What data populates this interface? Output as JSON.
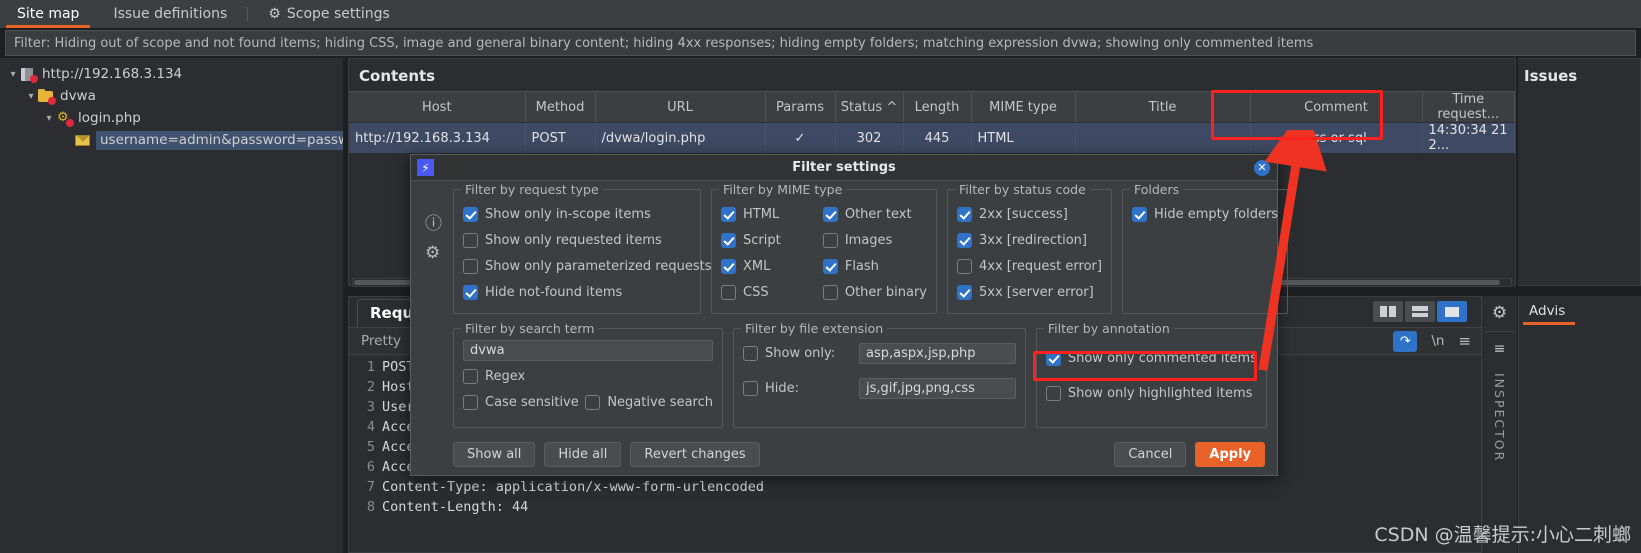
{
  "top_tabs": [
    {
      "label": "Site map",
      "active": true,
      "icon": null
    },
    {
      "label": "Issue definitions",
      "active": false,
      "icon": null
    },
    {
      "label": "Scope settings",
      "active": false,
      "icon": "gear-icon"
    }
  ],
  "filter_bar": {
    "text": "Filter: Hiding out of scope and not found items;  hiding CSS, image and general binary content;  hiding 4xx responses;  hiding empty folders;  matching expression dvwa;  showing only commented items"
  },
  "site_map_tree": [
    {
      "label": "http://192.168.3.134",
      "indent": 0,
      "icon": "host-icon",
      "expanded": true,
      "selected": false
    },
    {
      "label": "dvwa",
      "indent": 1,
      "icon": "folder-icon",
      "expanded": true,
      "selected": false
    },
    {
      "label": "login.php",
      "indent": 2,
      "icon": "php-gear-icon",
      "expanded": true,
      "selected": false
    },
    {
      "label": "username=admin&password=passwo",
      "indent": 3,
      "icon": "request-mail-icon",
      "expanded": false,
      "selected": true
    }
  ],
  "contents": {
    "title": "Contents",
    "columns": [
      "Host",
      "Method",
      "URL",
      "Params",
      "Status ^",
      "Length",
      "MIME type",
      "Title",
      "Comment",
      "Time request..."
    ],
    "rows": [
      {
        "Host": "http://192.168.3.134",
        "Method": "POST",
        "URL": "/dvwa/login.php",
        "Params": "✓",
        "Status": "302",
        "Length": "445",
        "MIME type": "HTML",
        "Title": "",
        "Comment": "xss or sql",
        "Time requested": "14:30:34 21 2..."
      }
    ]
  },
  "issues_panel": {
    "title": "Issues"
  },
  "request_panel": {
    "tab_label": "Reque",
    "pretty_label": "Pretty",
    "view_buttons": [
      {
        "name": "split-view-button",
        "active": false
      },
      {
        "name": "stacked-view-button",
        "active": false
      },
      {
        "name": "single-view-button",
        "active": true
      }
    ],
    "tools": [
      {
        "name": "word-wrap-button",
        "label": "",
        "active": true
      },
      {
        "name": "newline-button",
        "label": "\\n",
        "active": false
      },
      {
        "name": "menu-button",
        "label": "≡",
        "active": false
      }
    ],
    "gear_icon": "gear-icon",
    "code_lines": [
      {
        "n": "1",
        "text": "POST"
      },
      {
        "n": "2",
        "text": "Host"
      },
      {
        "n": "3",
        "text": "User"
      },
      {
        "n": "4",
        "text": "Acce"
      },
      {
        "n": "5",
        "text": "Acce"
      },
      {
        "n": "6",
        "text": "Accept-Encoding: gzip, deflate"
      },
      {
        "n": "7",
        "text": "Content-Type: application/x-www-form-urlencoded"
      },
      {
        "n": "8",
        "text": "Content-Length: 44"
      }
    ]
  },
  "inspector_rail": {
    "label": "INSPECTOR",
    "gear_icon": "gear-icon",
    "align_icon": "align-icon"
  },
  "advisory_panel": {
    "tab_label": "Advis"
  },
  "dialog": {
    "title": "Filter settings",
    "logo_icon": "burp-logo-icon",
    "close_icon": "close-icon",
    "side_icons": [
      "help-icon",
      "settings-gear-icon"
    ],
    "groups": {
      "request_type": {
        "caption": "Filter by request type",
        "items": [
          {
            "label": "Show only in-scope items",
            "checked": true
          },
          {
            "label": "Show only requested items",
            "checked": false
          },
          {
            "label": "Show only parameterized requests",
            "checked": false
          },
          {
            "label": "Hide not-found items",
            "checked": true
          }
        ]
      },
      "mime_type": {
        "caption": "Filter by MIME type",
        "left": [
          {
            "label": "HTML",
            "checked": true
          },
          {
            "label": "Script",
            "checked": true
          },
          {
            "label": "XML",
            "checked": true
          },
          {
            "label": "CSS",
            "checked": false
          }
        ],
        "right": [
          {
            "label": "Other text",
            "checked": true
          },
          {
            "label": "Images",
            "checked": false
          },
          {
            "label": "Flash",
            "checked": true
          },
          {
            "label": "Other binary",
            "checked": false
          }
        ]
      },
      "status_code": {
        "caption": "Filter by status code",
        "items": [
          {
            "label": "2xx  [success]",
            "checked": true
          },
          {
            "label": "3xx  [redirection]",
            "checked": true
          },
          {
            "label": "4xx  [request error]",
            "checked": false
          },
          {
            "label": "5xx  [server error]",
            "checked": true
          }
        ]
      },
      "folders": {
        "caption": "Folders",
        "items": [
          {
            "label": "Hide empty folders",
            "checked": true
          }
        ]
      },
      "search_term": {
        "caption": "Filter by search term",
        "value": "dvwa",
        "items": [
          {
            "label": "Regex",
            "checked": false
          },
          {
            "label": "Case sensitive",
            "checked": false
          },
          {
            "label": "Negative search",
            "checked": false
          }
        ]
      },
      "file_extension": {
        "caption": "Filter by file extension",
        "show_only": {
          "label": "Show only:",
          "checked": false,
          "value": "asp,aspx,jsp,php"
        },
        "hide": {
          "label": "Hide:",
          "checked": false,
          "value": "js,gif,jpg,png,css"
        }
      },
      "annotation": {
        "caption": "Filter by annotation",
        "items": [
          {
            "label": "Show only commented items",
            "checked": true,
            "highlighted": true
          },
          {
            "label": "Show only highlighted items",
            "checked": false,
            "highlighted": false
          }
        ]
      }
    },
    "buttons": {
      "show_all": "Show all",
      "hide_all": "Hide all",
      "revert": "Revert changes",
      "cancel": "Cancel",
      "apply": "Apply"
    }
  },
  "annotations": {
    "highlight_color": "#ff2020",
    "arrow_color": "#ee3322"
  },
  "watermark": {
    "text": "CSDN @温馨提示:小心二刺螂"
  },
  "colors": {
    "accent_orange": "#e8622a",
    "checkbox_blue": "#2f73c9",
    "selection_blue": "#3e4a63",
    "bg_dark": "#2b2d30",
    "bg_panel": "#3c3f41"
  }
}
